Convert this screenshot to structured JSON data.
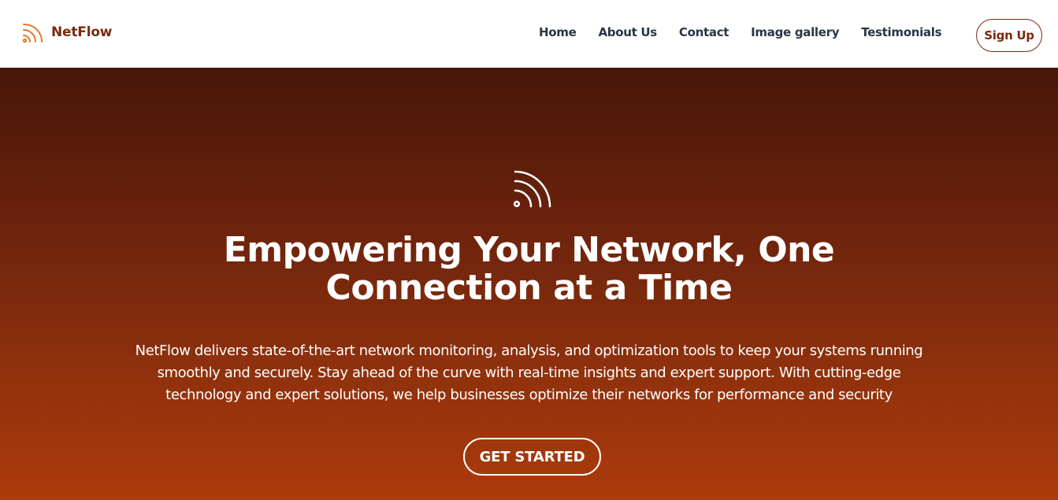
{
  "brand": {
    "name": "NetFlow",
    "icon": "rss-wave-icon",
    "color": "#e8742a"
  },
  "nav": {
    "links": [
      "Home",
      "About Us",
      "Contact",
      "Image gallery",
      "Testimonials"
    ],
    "signup_label": "Sign Up"
  },
  "hero": {
    "icon": "rss-wave-icon",
    "title": "Empowering Your Network, One Connection at a Time",
    "description": "NetFlow delivers state-of-the-art network monitoring, analysis, and optimization tools to keep your systems running smoothly and securely. Stay ahead of the curve with real-time insights and expert support. With cutting-edge technology and expert solutions, we help businesses optimize their networks for performance and security",
    "cta_label": "GET STARTED"
  },
  "colors": {
    "brand_text": "#7a2a0e",
    "nav_text": "#2b3445",
    "hero_gradient_top": "#47160a",
    "hero_gradient_bottom": "#ad3a0b"
  }
}
